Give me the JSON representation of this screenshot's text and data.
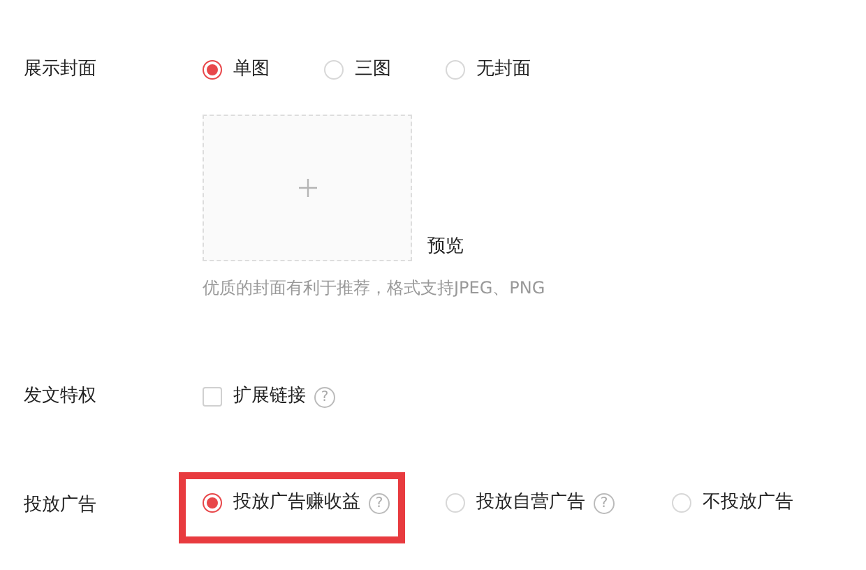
{
  "cover": {
    "label": "展示封面",
    "options": [
      {
        "label": "单图",
        "selected": true
      },
      {
        "label": "三图",
        "selected": false
      },
      {
        "label": "无封面",
        "selected": false
      }
    ],
    "preview": "预览",
    "hint": "优质的封面有利于推荐，格式支持JPEG、PNG"
  },
  "privilege": {
    "label": "发文特权",
    "options": [
      {
        "label": "扩展链接",
        "checked": false,
        "help": "?"
      }
    ]
  },
  "ads": {
    "label": "投放广告",
    "options": [
      {
        "label": "投放广告赚收益",
        "selected": true,
        "help": "?",
        "highlighted": true
      },
      {
        "label": "投放自营广告",
        "selected": false,
        "help": "?",
        "highlighted": false
      },
      {
        "label": "不投放广告",
        "selected": false,
        "highlighted": false
      }
    ]
  }
}
